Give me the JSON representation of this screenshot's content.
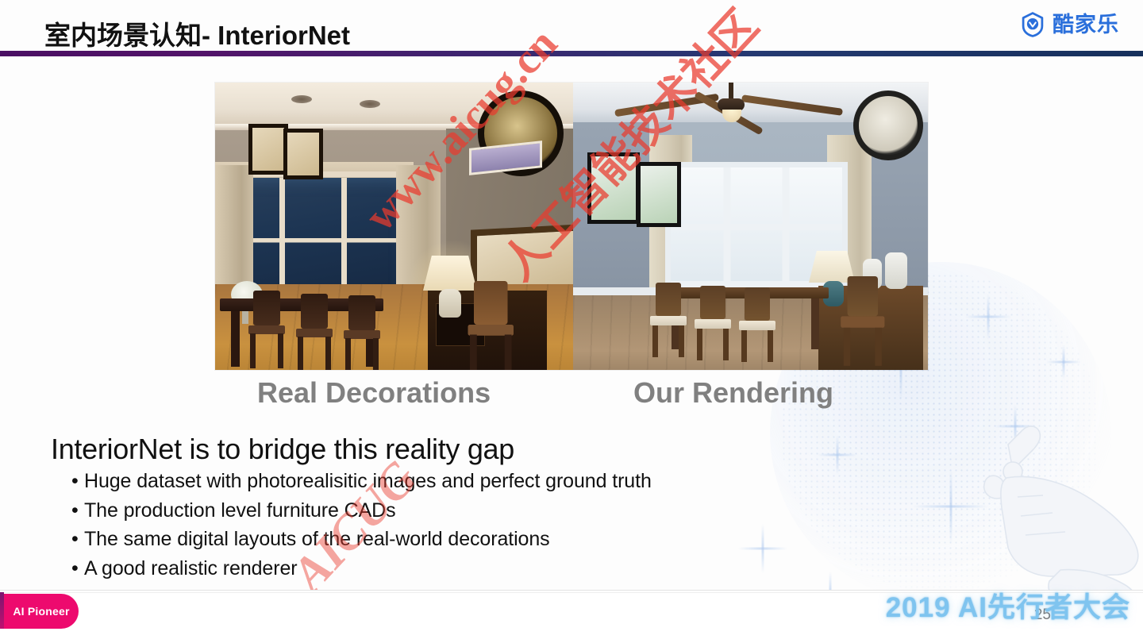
{
  "header": {
    "title_cn": "室内场景认知",
    "title_sep": "- ",
    "title_en": "InteriorNet",
    "brand_name": "酷家乐",
    "brand_icon": "shield-smile-icon",
    "brand_color": "#2a6fdb",
    "rule_color_left": "#4a0f63",
    "rule_color_right": "#16305c"
  },
  "media": {
    "left_caption": "Real Decorations",
    "right_caption": "Our Rendering",
    "caption_color": "#808080",
    "left_alt": "real photo of a dining room with wood table, chairs, window and sideboard",
    "right_alt": "rendered dining room with ceiling fan, wood table, chairs and window"
  },
  "body": {
    "headline": "InteriorNet is to bridge this reality gap",
    "bullets": [
      "Huge dataset with photorealisitic images and perfect ground truth",
      "The production level furniture CADs",
      "The same digital layouts of the real-world decorations",
      "A good realistic renderer"
    ],
    "bullet_glyph": "•"
  },
  "watermarks": {
    "url": "www.aicug.cn",
    "cn": "人工智能技术社区",
    "brand": "AICUG",
    "color": "#ea3b2e"
  },
  "footer": {
    "badge_label": "AI Pioneer",
    "badge_color": "#ed0a6e",
    "conference_logo": "2019 AI先行者大会",
    "conference_color": "#7fc4ef",
    "page_number": "25"
  }
}
